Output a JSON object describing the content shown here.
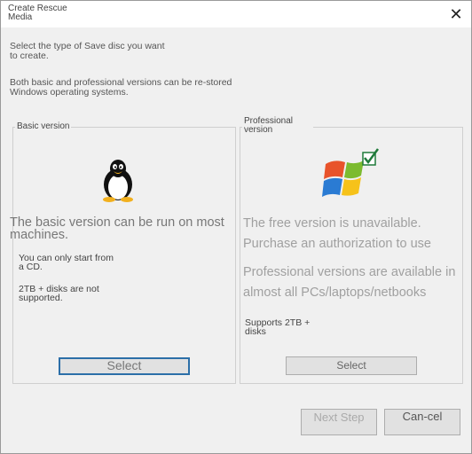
{
  "window": {
    "title": "Create Rescue Media",
    "close_glyph": "✕"
  },
  "intro": {
    "line1": "Select the type of Save disc you want to create.",
    "line2": "Both basic and professional versions can be re-stored Windows operating systems."
  },
  "basic": {
    "group_label": "Basic version",
    "icon": "linux-penguin-icon",
    "description": "The basic version can be run on most machines.",
    "note1": "You can only start from a CD.",
    "note2": "2TB + disks are not supported.",
    "select_label": "Select"
  },
  "professional": {
    "group_label": "Professional version",
    "icon": "windows-logo-checkmark-icon",
    "description1": "The free version is unavailable. Purchase an authorization to use professional",
    "description2": "Professional versions are available in almost all PCs/laptops/netbooks",
    "note": "Supports 2TB + disks",
    "select_label": "Select"
  },
  "footer": {
    "next_label": "Next Step",
    "cancel_label": "Can-cel"
  },
  "colors": {
    "focus_border": "#2c6fa8",
    "check_green": "#1f7a3a"
  }
}
